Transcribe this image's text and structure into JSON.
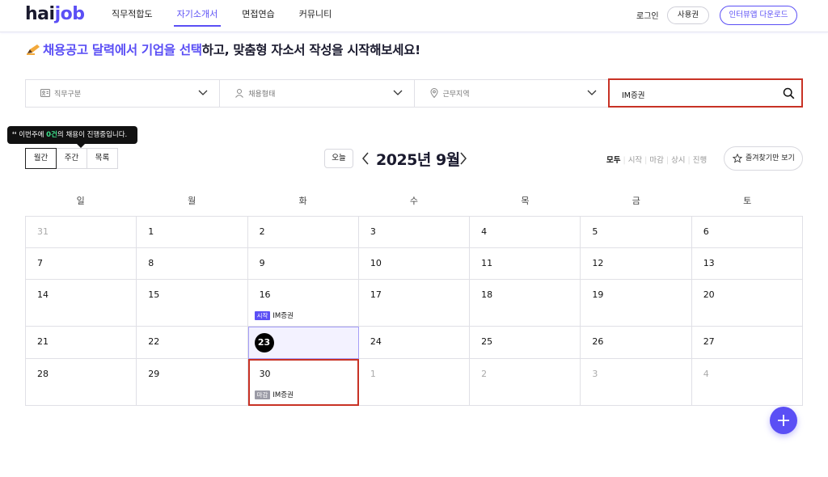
{
  "header": {
    "logo_prefix": "hai",
    "logo_suffix": "job",
    "nav": [
      "직무적합도",
      "자기소개서",
      "면접연습",
      "커뮤니티"
    ],
    "active_nav": "자기소개서",
    "login": "로그인",
    "corporate": "사용권",
    "download": "인터뷰앱 다운로드"
  },
  "headline": {
    "part1": "채용공고 달력에서 기업을 선택",
    "part2": "하고, 맞춤형 자소서 작성을 시작해보세요!"
  },
  "filters": {
    "job": "직무구분",
    "employment": "채용형태",
    "location": "근무지역",
    "search_value": "IM증권"
  },
  "tooltip": {
    "pre": "이번주에 ",
    "count": "0건",
    "post": "의 채용이 진행중입니다."
  },
  "view_tabs": [
    "월간",
    "주간",
    "목록"
  ],
  "month_nav": {
    "today": "오늘",
    "title": "2025년 9월"
  },
  "status_filters": [
    "모두",
    "시작",
    "마감",
    "상시",
    "진행"
  ],
  "favorites_button": "즐겨찾기만 보기",
  "weekdays": [
    "일",
    "월",
    "화",
    "수",
    "목",
    "금",
    "토"
  ],
  "weeks": [
    [
      {
        "d": "31",
        "o": true
      },
      {
        "d": "1"
      },
      {
        "d": "2"
      },
      {
        "d": "3"
      },
      {
        "d": "4"
      },
      {
        "d": "5"
      },
      {
        "d": "6"
      }
    ],
    [
      {
        "d": "7"
      },
      {
        "d": "8"
      },
      {
        "d": "9"
      },
      {
        "d": "10"
      },
      {
        "d": "11"
      },
      {
        "d": "12"
      },
      {
        "d": "13"
      }
    ],
    [
      {
        "d": "14"
      },
      {
        "d": "15"
      },
      {
        "d": "16",
        "event": {
          "badge": "시작",
          "type": "start",
          "name": "IM증권"
        }
      },
      {
        "d": "17"
      },
      {
        "d": "18"
      },
      {
        "d": "19"
      },
      {
        "d": "20"
      }
    ],
    [
      {
        "d": "21"
      },
      {
        "d": "22"
      },
      {
        "d": "23",
        "today": true
      },
      {
        "d": "24"
      },
      {
        "d": "25"
      },
      {
        "d": "26"
      },
      {
        "d": "27"
      }
    ],
    [
      {
        "d": "28"
      },
      {
        "d": "29"
      },
      {
        "d": "30",
        "highlight": true,
        "event": {
          "badge": "마감",
          "type": "end",
          "name": "IM증권"
        }
      },
      {
        "d": "1",
        "o": true
      },
      {
        "d": "2",
        "o": true
      },
      {
        "d": "3",
        "o": true
      },
      {
        "d": "4",
        "o": true
      }
    ]
  ],
  "colors": {
    "accent": "#5b4ff5",
    "highlight_border": "#c83225",
    "end_badge": "#9b9ba6"
  }
}
